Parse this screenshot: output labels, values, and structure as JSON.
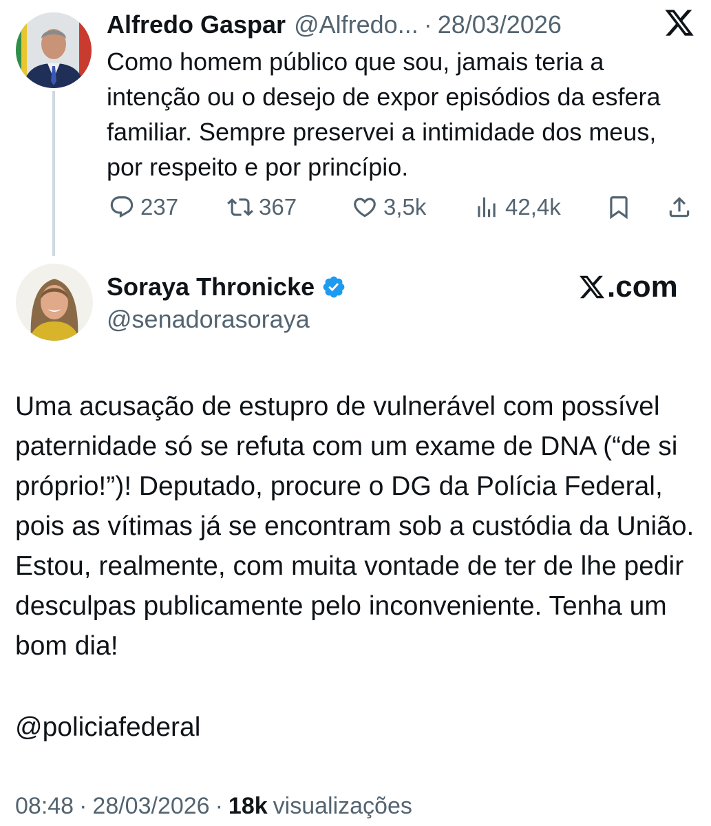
{
  "quoted_tweet": {
    "author_name": "Alfredo Gaspar",
    "author_handle": "@Alfredo...",
    "separator": "·",
    "date": "28/03/2026",
    "text": "Como homem público que sou, jamais teria a intenção ou o desejo de expor episódios da esfera familiar. Sempre preservei a intimidade dos meus, por respeito e por princípio.",
    "replies": "237",
    "retweets": "367",
    "likes": "3,5k",
    "views": "42,4k"
  },
  "main_tweet": {
    "author_name": "Soraya Thronicke",
    "verified": true,
    "author_handle": "@senadorasoraya",
    "brand_label": ".com",
    "text": "Uma acusação de estupro de vulnerável com possível paternidade só se refuta com um exame de DNA (“de si próprio!”)! Deputado, procure o DG da Polícia Federal, pois as vítimas já se encontram sob a custódia da União. Estou, realmente, com muita vontade de ter de lhe pedir desculpas publicamente pelo inconveniente. Tenha um bom dia!",
    "mention": "@policiafederal",
    "time": "08:48",
    "separator": "·",
    "date": "28/03/2026",
    "views_count": "18k",
    "views_label": "visualizações"
  },
  "icons": {
    "x_logo": "x-logo-icon",
    "reply": "reply-icon",
    "retweet": "retweet-icon",
    "like": "heart-icon",
    "views": "views-icon",
    "bookmark": "bookmark-icon",
    "share": "share-icon",
    "verified": "verified-badge-icon"
  },
  "colors": {
    "text": "#0f1419",
    "secondary": "#536471",
    "verified_blue": "#1d9bf0",
    "thread_line": "#cfd9de"
  }
}
